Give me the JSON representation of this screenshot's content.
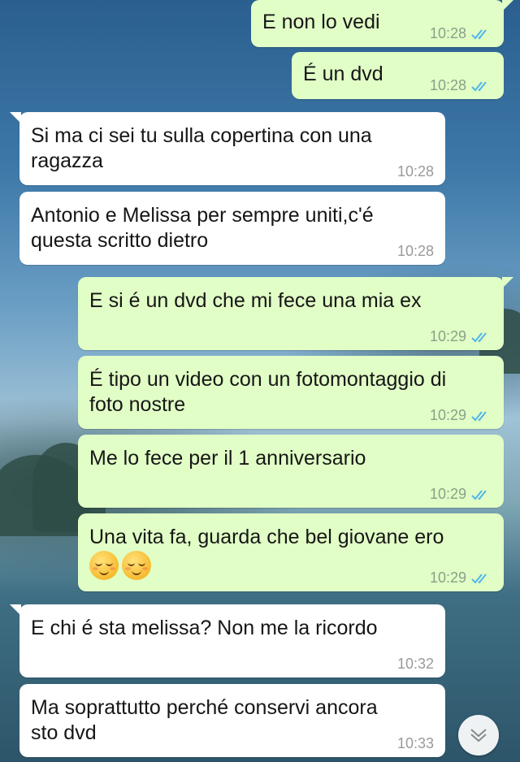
{
  "messages": [
    {
      "dir": "out",
      "text": "E non lo vedi",
      "time": "10:28",
      "status_icon": "double-check-icon"
    },
    {
      "dir": "out",
      "text": "É un dvd",
      "time": "10:28",
      "status_icon": "double-check-icon"
    },
    {
      "dir": "in",
      "text": "Si ma ci sei tu sulla copertina con una\nragazza",
      "time": "10:28"
    },
    {
      "dir": "in",
      "text": "Antonio e Melissa per sempre uniti,c'é\nquesta scritto dietro",
      "time": "10:28"
    },
    {
      "dir": "out",
      "text": "E si é un dvd che mi fece una mia ex",
      "time": "10:29",
      "status_icon": "double-check-icon"
    },
    {
      "dir": "out",
      "text": "É tipo un video con un fotomontaggio di\nfoto nostre",
      "time": "10:29",
      "status_icon": "double-check-icon"
    },
    {
      "dir": "out",
      "text": "Me lo fece per il 1 anniversario",
      "time": "10:29",
      "status_icon": "double-check-icon"
    },
    {
      "dir": "out",
      "text": "Una vita fa, guarda che bel giovane ero",
      "time": "10:29",
      "status_icon": "double-check-icon",
      "emoji": [
        "relieved-face-emoji",
        "relieved-face-emoji"
      ]
    },
    {
      "dir": "in",
      "text": "E chi é sta melissa? Non me la ricordo",
      "time": "10:32"
    },
    {
      "dir": "in",
      "text": "Ma soprattutto perché conservi ancora\nsto dvd",
      "time": "10:33"
    }
  ],
  "colors": {
    "outgoing_bubble": "#e1fec6",
    "incoming_bubble": "#ffffff",
    "read_ticks": "#4fb6ec",
    "time_text": "#9a9a9a"
  },
  "scroll_button": {
    "icon": "chevron-down-icon"
  }
}
